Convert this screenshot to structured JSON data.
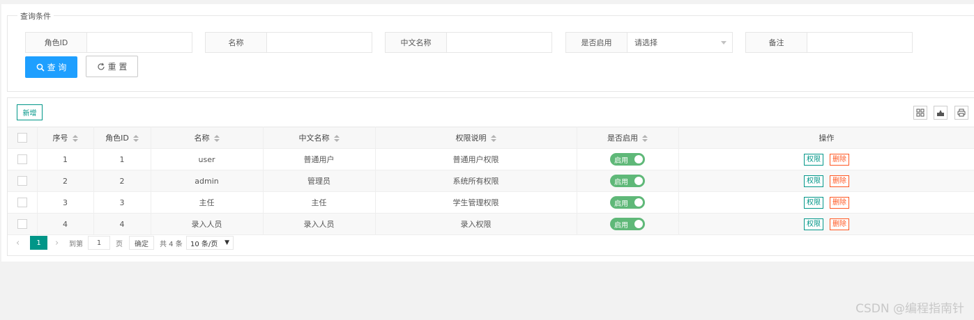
{
  "query": {
    "legend": "查询条件",
    "fields": [
      {
        "label": "角色ID",
        "value": ""
      },
      {
        "label": "名称",
        "value": ""
      },
      {
        "label": "中文名称",
        "value": ""
      },
      {
        "label": "是否启用",
        "value": "请选择"
      },
      {
        "label": "备注",
        "value": ""
      }
    ],
    "search_label": "查 询",
    "reset_label": "重 置"
  },
  "toolbar": {
    "add_label": "新增",
    "icons": [
      "columns-icon",
      "export-icon",
      "print-icon"
    ]
  },
  "table": {
    "headers": [
      "序号",
      "角色ID",
      "名称",
      "中文名称",
      "权限说明",
      "是否启用",
      "操作"
    ],
    "rows": [
      {
        "no": "1",
        "role_id": "1",
        "name": "user",
        "cn_name": "普通用户",
        "desc": "普通用户权限",
        "enabled": "启用"
      },
      {
        "no": "2",
        "role_id": "2",
        "name": "admin",
        "cn_name": "管理员",
        "desc": "系统所有权限",
        "enabled": "启用"
      },
      {
        "no": "3",
        "role_id": "3",
        "name": "主任",
        "cn_name": "主任",
        "desc": "学生管理权限",
        "enabled": "启用"
      },
      {
        "no": "4",
        "role_id": "4",
        "name": "录入人员",
        "cn_name": "录入人员",
        "desc": "录入权限",
        "enabled": "启用"
      }
    ],
    "perm_label": "权限",
    "delete_label": "删除"
  },
  "pager": {
    "current": "1",
    "goto_label": "到第",
    "goto_value": "1",
    "page_label": "页",
    "confirm_label": "确定",
    "total_label": "共 4 条",
    "page_size": "10 条/页"
  },
  "watermark": "CSDN @编程指南针",
  "colors": {
    "primary": "#1e9fff",
    "accent": "#009688",
    "switch_on": "#5fb878",
    "danger": "#ff5722"
  }
}
